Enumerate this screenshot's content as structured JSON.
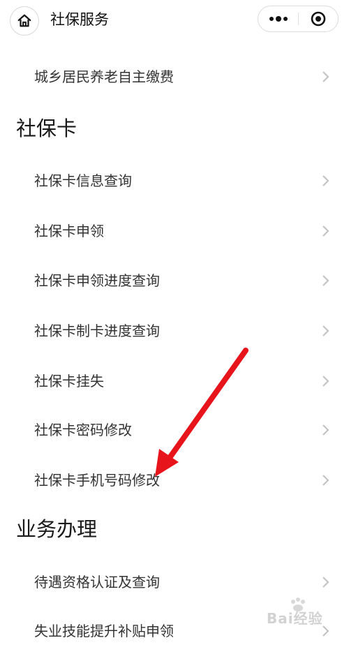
{
  "header": {
    "title": "社保服务",
    "home_icon": "home-icon",
    "more_icon": "more-dots-icon",
    "close_icon": "target-close-icon"
  },
  "top_items": [
    {
      "label": "城乡居民养老自主缴费"
    }
  ],
  "sections": [
    {
      "title": "社保卡",
      "items": [
        {
          "label": "社保卡信息查询"
        },
        {
          "label": "社保卡申领"
        },
        {
          "label": "社保卡申领进度查询"
        },
        {
          "label": "社保卡制卡进度查询"
        },
        {
          "label": "社保卡挂失"
        },
        {
          "label": "社保卡密码修改"
        },
        {
          "label": "社保卡手机号码修改"
        }
      ]
    },
    {
      "title": "业务办理",
      "items": [
        {
          "label": "待遇资格认证及查询"
        },
        {
          "label": "失业技能提升补贴申领"
        }
      ]
    }
  ],
  "annotation": {
    "color": "#e8141c"
  },
  "watermark": {
    "text": "Bai经验"
  }
}
